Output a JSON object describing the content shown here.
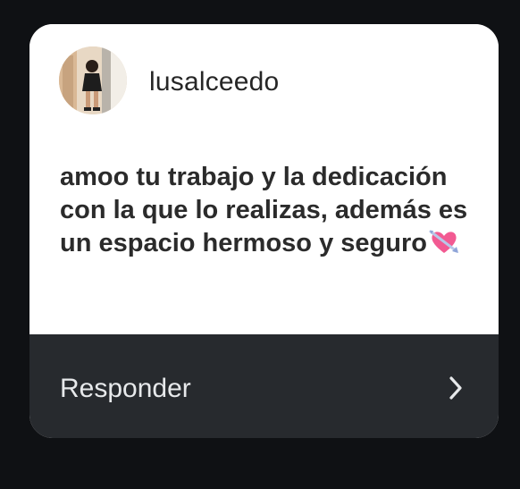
{
  "question_card": {
    "username": "lusalceedo",
    "message_text": "amoo tu trabajo y la dedicación con la que lo realizas, además es un espacio hermoso y seguro",
    "message_emoji": "heart-with-arrow",
    "reply_label": "Responder"
  },
  "colors": {
    "background": "#0f1114",
    "card": "#ffffff",
    "footer": "#272a2e",
    "text_dark": "#2b2b2b",
    "text_light": "#e7e9eb",
    "emoji_pink": "#f25a92"
  },
  "icons": {
    "avatar": "profile-photo",
    "reply": "chevron-right-icon",
    "emoji": "heart-with-arrow-icon"
  }
}
